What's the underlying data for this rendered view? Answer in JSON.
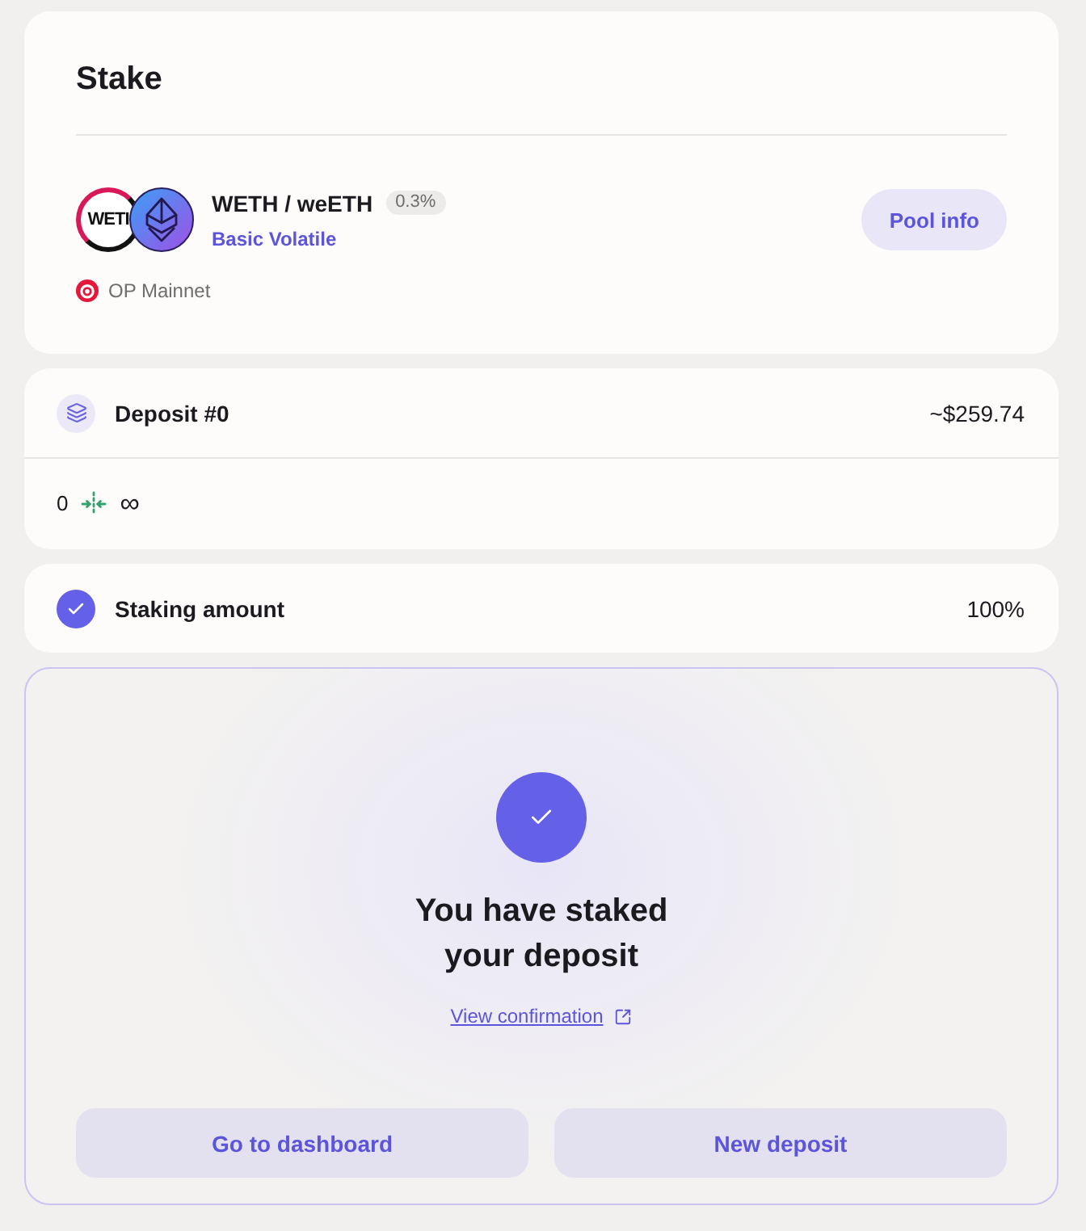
{
  "stake_card": {
    "title": "Stake",
    "pool": {
      "logo_text": "WETI",
      "pair": "WETH / weETH",
      "fee": "0.3%",
      "pool_type": "Basic Volatile",
      "pool_info_button": "Pool info",
      "network": "OP Mainnet"
    }
  },
  "deposit_card": {
    "title": "Deposit #0",
    "value": "~$259.74",
    "range_min": "0",
    "range_max": "∞"
  },
  "staking_amount": {
    "label": "Staking amount",
    "checked": true,
    "value": "100%"
  },
  "success": {
    "heading": "You have staked your deposit",
    "link": "View confirmation",
    "buttons": [
      "Go to dashboard",
      "New deposit"
    ]
  }
}
